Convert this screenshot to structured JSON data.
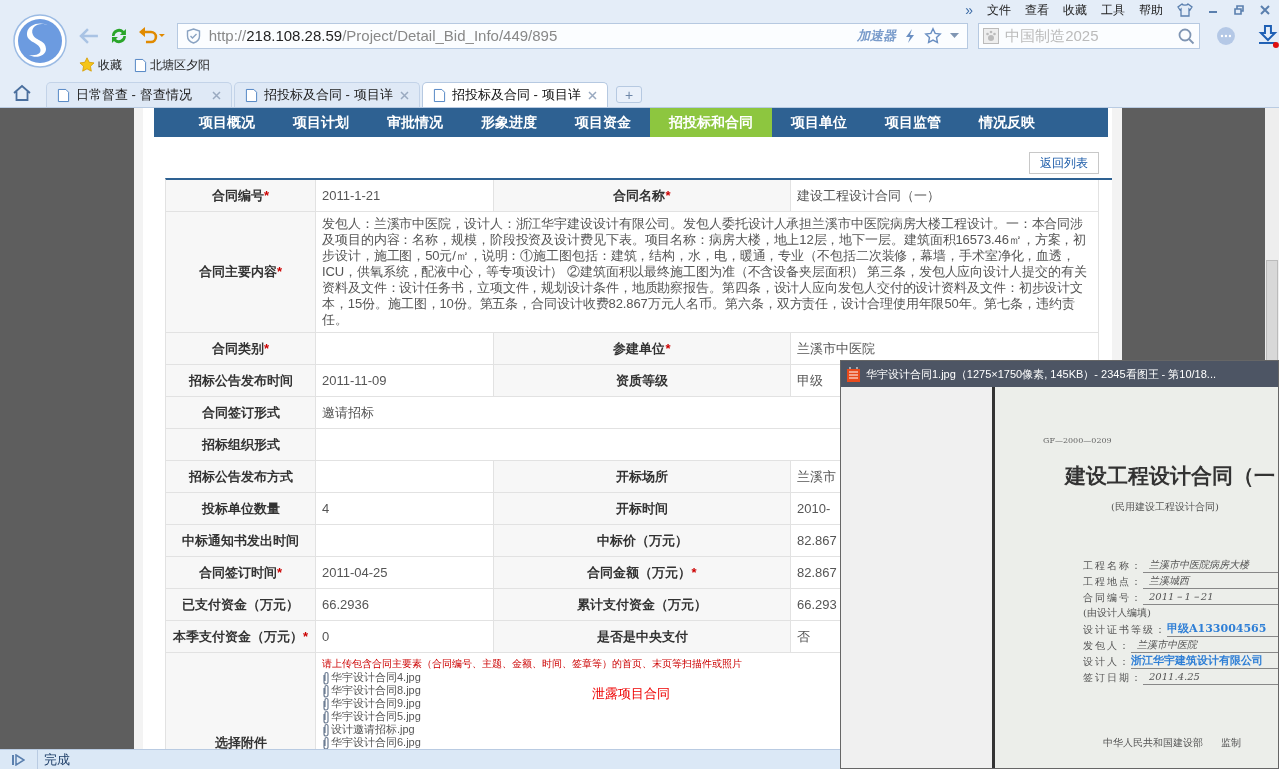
{
  "browser": {
    "menu_more": "»",
    "menu": [
      "文件",
      "查看",
      "收藏",
      "工具",
      "帮助"
    ],
    "address": {
      "scheme": "http://",
      "host": "218.108.28.59",
      "path": "/Project/Detail_Bid_Info/449/895"
    },
    "accelerator": "加速器",
    "search_placeholder": "中国制造2025",
    "bookmarks": [
      {
        "kind": "star",
        "label": "收藏"
      },
      {
        "kind": "page",
        "label": "北塘区夕阳"
      }
    ],
    "tabs": [
      {
        "title": "日常督查 - 督查情况",
        "selected": false
      },
      {
        "title": "招投标及合同 - 项目详",
        "selected": false
      },
      {
        "title": "招投标及合同 - 项目详",
        "selected": true
      }
    ],
    "new_tab": "+"
  },
  "nav": [
    {
      "label": "项目概况",
      "selected": false
    },
    {
      "label": "项目计划",
      "selected": false
    },
    {
      "label": "审批情况",
      "selected": false
    },
    {
      "label": "形象进度",
      "selected": false
    },
    {
      "label": "项目资金",
      "selected": false
    },
    {
      "label": "招投标和合同",
      "selected": true
    },
    {
      "label": "项目单位",
      "selected": false
    },
    {
      "label": "项目监管",
      "selected": false
    },
    {
      "label": "情况反映",
      "selected": false
    }
  ],
  "back_button": "返回列表",
  "table": [
    {
      "kind": "pair",
      "cells": [
        {
          "label": "合同编号",
          "mark": "*",
          "value": "2011-1-21"
        },
        {
          "label": "合同名称",
          "mark": "*",
          "value": "建设工程设计合同（一）"
        }
      ]
    },
    {
      "kind": "text",
      "label": "合同主要内容",
      "mark": "*",
      "value": "发包人：兰溪市中医院，设计人：浙江华宇建设设计有限公司。发包人委托设计人承担兰溪市中医院病房大楼工程设计。一：本合同涉及项目的内容：名称，规模，阶段投资及设计费见下表。项目名称：病房大楼，地上12层，地下一层。建筑面积16573.46㎡，方案，初步设计，施工图，50元/㎡，说明：①施工图包括：建筑，结构，水，电，暖通，专业（不包括二次装修，幕墙，手术室净化，血透，ICU，供氧系统，配液中心，等专项设计） ②建筑面积以最终施工图为准（不含设备夹层面积） 第三条，发包人应向设计人提交的有关资料及文件：设计任务书，立项文件，规划设计条件，地质勘察报告。第四条，设计人应向发包人交付的设计资料及文件：初步设计文本，15份。施工图，10份。第五条，合同设计收费82.867万元人名币。第六条，双方责任，设计合理使用年限50年。第七条，违约责任。"
    },
    {
      "kind": "pair",
      "cells": [
        {
          "label": "合同类别",
          "mark": "*"
        },
        {
          "label": "参建单位",
          "mark": "*",
          "value": "兰溪市中医院"
        }
      ]
    },
    {
      "kind": "pair",
      "cells": [
        {
          "label": "招标公告发布时间",
          "value": "2011-11-09"
        },
        {
          "label": "资质等级",
          "value": "甲级"
        }
      ]
    },
    {
      "kind": "wide",
      "label": "合同签订形式",
      "value": "邀请招标"
    },
    {
      "kind": "wide",
      "label": "招标组织形式"
    },
    {
      "kind": "pair",
      "cells": [
        {
          "label": "招标公告发布方式"
        },
        {
          "label": "开标场所",
          "value": "兰溪市"
        }
      ]
    },
    {
      "kind": "pair",
      "cells": [
        {
          "label": "投标单位数量",
          "value": "4"
        },
        {
          "label": "开标时间",
          "value": "2010-"
        }
      ]
    },
    {
      "kind": "pair",
      "cells": [
        {
          "label": "中标通知书发出时间"
        },
        {
          "label": "中标价（万元）",
          "value": "82.867"
        }
      ]
    },
    {
      "kind": "pair",
      "cells": [
        {
          "label": "合同签订时间",
          "mark": "*",
          "value": "2011-04-25"
        },
        {
          "label": "合同金额（万元）",
          "mark": "*",
          "value": "82.867"
        }
      ]
    },
    {
      "kind": "pair",
      "cells": [
        {
          "label": "已支付资金（万元）",
          "value": "66.2936"
        },
        {
          "label": "累计支付资金（万元）",
          "value": "66.293"
        }
      ]
    },
    {
      "kind": "pair",
      "cells": [
        {
          "label": "本季支付资金（万元）",
          "mark": "*",
          "value": "0"
        },
        {
          "label": "是否是中央支付",
          "value": "否"
        }
      ]
    },
    {
      "kind": "attachments",
      "label": "选择附件",
      "notice": "请上传包含合同主要素（合同编号、主题、金额、时间、签章等）的首页、末页等扫描件或照片",
      "files": [
        "华宇设计合同4.jpg",
        "华宇设计合同8.jpg",
        "华宇设计合同9.jpg",
        "华宇设计合同5.jpg",
        "设计邀请招标.jpg",
        "华宇设计合同6.jpg"
      ],
      "remark": "泄露项目合同"
    }
  ],
  "viewer": {
    "title": "华宇设计合同1.jpg（1275×1750像素, 145KB）- 2345看图王 - 第10/18...",
    "document": {
      "code": "GF—2000—0209",
      "title": "建设工程设计合同（一",
      "subtitle": "(民用建设工程设计合同)",
      "fields": [
        {
          "kind": "handwritten",
          "label": "工程名称：",
          "value": "兰溪市中医院病房大楼"
        },
        {
          "kind": "handwritten",
          "label": "工程地点：",
          "value": "兰溪城西"
        },
        {
          "kind": "handwritten",
          "label": "合同编号：",
          "value": "2011－1－21"
        },
        {
          "kind": "note",
          "label": "(由设计人编填)"
        },
        {
          "kind": "stamp",
          "label": "设计证书等级：",
          "value": "甲级A133004565"
        },
        {
          "kind": "handwritten",
          "label": "发包人：",
          "value": "兰溪市中医院"
        },
        {
          "kind": "stamp",
          "label": "设计人：",
          "value": "浙江华宇建筑设计有限公司"
        },
        {
          "kind": "handwritten",
          "label": "签订日期：",
          "value": "2011.4.25"
        }
      ],
      "footer": "中华人民共和国建设部",
      "footer_right": "监制"
    }
  },
  "status": "完成"
}
